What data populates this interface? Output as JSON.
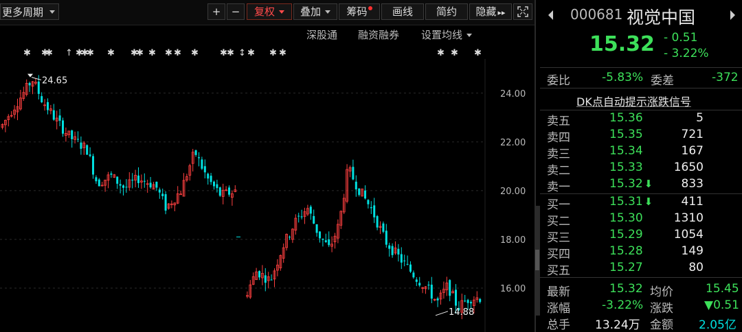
{
  "toolbar": {
    "period_label": "更多周期",
    "zoom_in": "+",
    "zoom_out": "−",
    "fuquan": "复权",
    "overlay": "叠加",
    "chips": "筹码",
    "draw": "画线",
    "simple": "简约",
    "hide": "隐藏",
    "more": "▸▸"
  },
  "subbar": {
    "hk_connect": "深股通",
    "margin": "融资融券",
    "ma_settings": "设置均线"
  },
  "chart": {
    "high_label": "24.65",
    "low_label": "14.88",
    "y_ticks": [
      "24.00",
      "22.00",
      "20.00",
      "18.00",
      "16.00"
    ]
  },
  "chart_data": {
    "type": "candlestick",
    "y_ticks": [
      24.0,
      22.0,
      20.0,
      18.0,
      16.0
    ],
    "max_marker": 24.65,
    "min_marker": 14.88,
    "ylim": [
      14.2,
      25.4
    ]
  },
  "quote": {
    "code": "000681",
    "name": "视觉中国",
    "price": "15.32",
    "change": "- 0.51",
    "change_pct": "- 3.22%"
  },
  "ratio": {
    "wb_label": "委比",
    "wb_value": "-5.83%",
    "wc_label": "委差",
    "wc_value": "-372"
  },
  "dk_signal": "DK点自动提示涨跌信号",
  "asks": [
    {
      "label": "卖五",
      "price": "15.36",
      "vol": "5",
      "arrow": ""
    },
    {
      "label": "卖四",
      "price": "15.35",
      "vol": "721",
      "arrow": ""
    },
    {
      "label": "卖三",
      "price": "15.34",
      "vol": "167",
      "arrow": ""
    },
    {
      "label": "卖二",
      "price": "15.33",
      "vol": "1650",
      "arrow": ""
    },
    {
      "label": "卖一",
      "price": "15.32",
      "vol": "833",
      "arrow": "⬇"
    }
  ],
  "bids": [
    {
      "label": "买一",
      "price": "15.31",
      "vol": "411",
      "arrow": "⬇"
    },
    {
      "label": "买二",
      "price": "15.30",
      "vol": "1310",
      "arrow": ""
    },
    {
      "label": "买三",
      "price": "15.29",
      "vol": "1054",
      "arrow": ""
    },
    {
      "label": "买四",
      "price": "15.28",
      "vol": "149",
      "arrow": ""
    },
    {
      "label": "买五",
      "price": "15.27",
      "vol": "80",
      "arrow": ""
    }
  ],
  "stats": {
    "latest_label": "最新",
    "latest": "15.32",
    "avg_label": "均价",
    "avg": "15.45",
    "pct_label": "涨幅",
    "pct": "-3.22%",
    "chg_label": "涨跌",
    "chg": "▼0.51",
    "vol_label": "总手",
    "vol": "13.24万",
    "amt_label": "金额",
    "amt": "2.05亿"
  },
  "colors": {
    "up": "#ff4040",
    "down": "#00e0e0",
    "green": "#3de05a"
  }
}
